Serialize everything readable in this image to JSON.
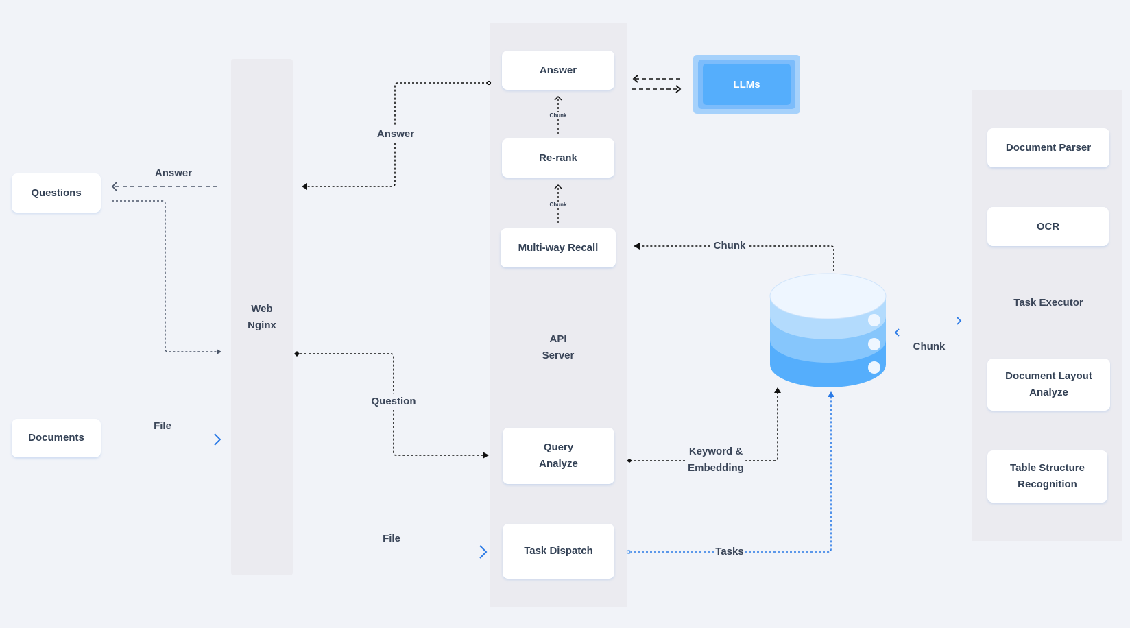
{
  "clients": {
    "questions": "Questions",
    "documents": "Documents"
  },
  "web": {
    "line1": "Web",
    "line2": "Nginx"
  },
  "api_server": {
    "line1": "API",
    "line2": "Server",
    "modules": {
      "answer": "Answer",
      "rerank": "Re-rank",
      "recall": "Multi-way Recall",
      "query_line1": "Query",
      "query_line2": "Analyze",
      "dispatch": "Task Dispatch"
    }
  },
  "llms": {
    "label": "LLMs"
  },
  "database": {
    "icon": "database-icon"
  },
  "task_executor": {
    "title": "Task Executor",
    "modules": {
      "parser": "Document Parser",
      "ocr": "OCR",
      "layout_line1": "Document Layout",
      "layout_line2": "Analyze",
      "table_line1": "Table Structure",
      "table_line2": "Recognition"
    }
  },
  "edges": {
    "answer_to_questions": "Answer",
    "answer_to_web": "Answer",
    "question_to_query": "Question",
    "file_from_documents": "File",
    "file_to_dispatch": "File",
    "chunk_rerank_to_answer": "Chunk",
    "chunk_recall_to_rerank": "Chunk",
    "chunk_db_to_recall": "Chunk",
    "keyword_line1": "Keyword &",
    "keyword_line2": "Embedding",
    "tasks": "Tasks",
    "chunk_executor_db": "Chunk"
  },
  "colors": {
    "background": "#f1f3f8",
    "panel": "#ebebf0",
    "box": "#ffffff",
    "text": "#334155",
    "flow_black": "#111111",
    "flow_gray": "#4a5568",
    "flow_blue": "#2b7ae6",
    "llm_outer": "#a6d1fb",
    "llm_mid": "#7cbcfb",
    "llm_inner": "#55aefc",
    "db_top": "#eef6ff",
    "db_band1": "#b3dbfd",
    "db_band2": "#86c6fc",
    "db_band3": "#55aefc"
  }
}
